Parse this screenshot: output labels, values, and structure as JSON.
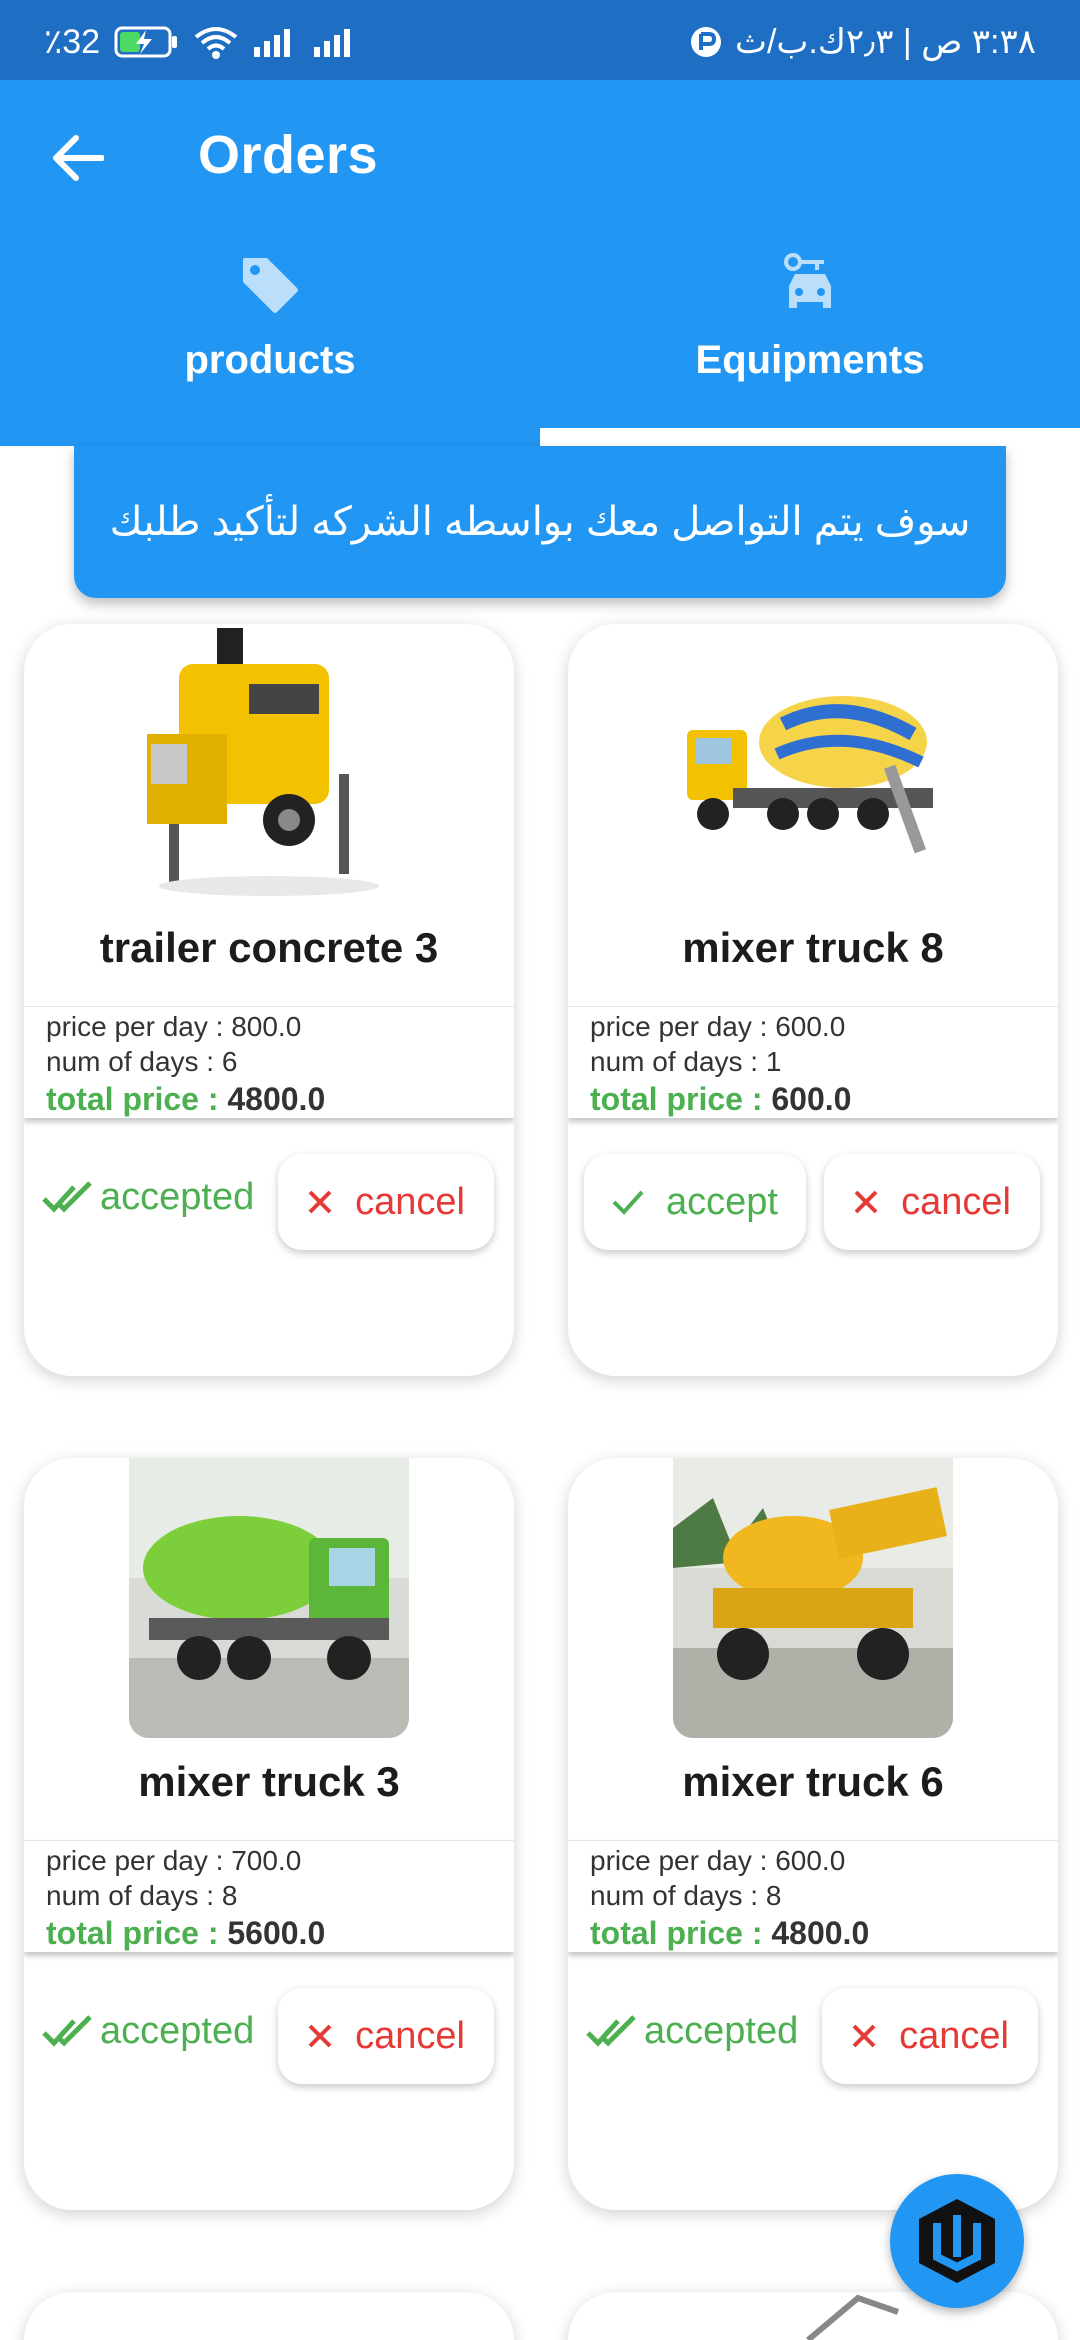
{
  "status_bar": {
    "battery": "32",
    "battery_suffix": "٪",
    "time_text": "٣:٣٨ ص | ٢٫٣ك.ب/ث"
  },
  "app_bar": {
    "title": "Orders"
  },
  "tabs": [
    {
      "label": "products",
      "icon": "tag-icon"
    },
    {
      "label": "Equipments",
      "icon": "car-key-icon"
    }
  ],
  "banner": {
    "text": "سوف يتم التواصل معك بواسطه الشركه لتأكيد طلبك"
  },
  "labels": {
    "price_per_day": "price per day : ",
    "num_days": "num of days : ",
    "total_price": "total price : ",
    "accepted": "accepted",
    "accept": "accept",
    "cancel": "cancel"
  },
  "cards": [
    {
      "name": "trailer concrete 3",
      "price_per_day": "800.0",
      "num_days": "6",
      "total": "4800.0",
      "status": "accepted"
    },
    {
      "name": "mixer truck 8",
      "price_per_day": "600.0",
      "num_days": "1",
      "total": "600.0",
      "status": "pending"
    },
    {
      "name": "mixer truck 3",
      "price_per_day": "700.0",
      "num_days": "8",
      "total": "5600.0",
      "status": "accepted"
    },
    {
      "name": "mixer truck 6",
      "price_per_day": "600.0",
      "num_days": "8",
      "total": "4800.0",
      "status": "accepted"
    }
  ],
  "colors": {
    "primary": "#2196f3",
    "status_bar": "#1e6fc4",
    "accept": "#4caf50",
    "cancel": "#e53935"
  }
}
